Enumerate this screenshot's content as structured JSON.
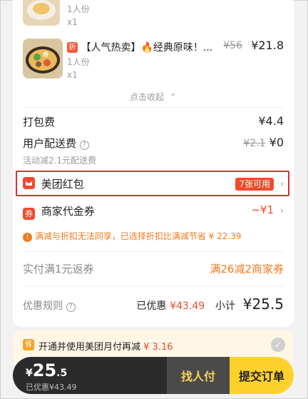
{
  "items": [
    {
      "name": "",
      "portion": "1人份",
      "qty": "x1"
    },
    {
      "badge": "折",
      "name": "【人气热卖】🔥经典原味！...",
      "original_price": "¥56",
      "price": "¥21.8",
      "portion": "1人份",
      "qty": "x1"
    }
  ],
  "collapse_label": "点击收起",
  "packing_fee": {
    "label": "打包费",
    "value": "¥4.4"
  },
  "delivery_fee": {
    "label": "用户配送费",
    "original": "¥2.1",
    "value": "¥0",
    "note": "活动减2.1元配送费"
  },
  "red_packet": {
    "label": "美团红包",
    "tag": "7张可用",
    "icon": "red-packet-icon"
  },
  "voucher": {
    "icon_text": "券",
    "label": "商家代金券",
    "value": "−¥1"
  },
  "notice": {
    "text": "满减与折扣无法同享，已选择折扣比满减节省 ¥ 22.39"
  },
  "rebate": {
    "label": "实付满1元返券",
    "value": "满26减2商家券"
  },
  "summary": {
    "rules_label": "优惠规则",
    "saved_label": "已优惠",
    "saved_value": "¥43.49",
    "subtotal_label": "小计",
    "subtotal_value": "¥25.5"
  },
  "banner": {
    "icon_text": "省",
    "text": "开通并使用美团月付再减",
    "amount": "¥ 3.16"
  },
  "bottom_bar": {
    "currency": "¥",
    "price_int": "25",
    "price_dec": ".5",
    "saved_text": "已优惠¥43.49",
    "find_pay_label": "找人付",
    "submit_label": "提交订单"
  },
  "colors": {
    "accent_red": "#f24a2b",
    "highlight_red": "#e8282c",
    "submit_yellow": "#ffd12c",
    "bar_dark": "#2b2b2b"
  }
}
